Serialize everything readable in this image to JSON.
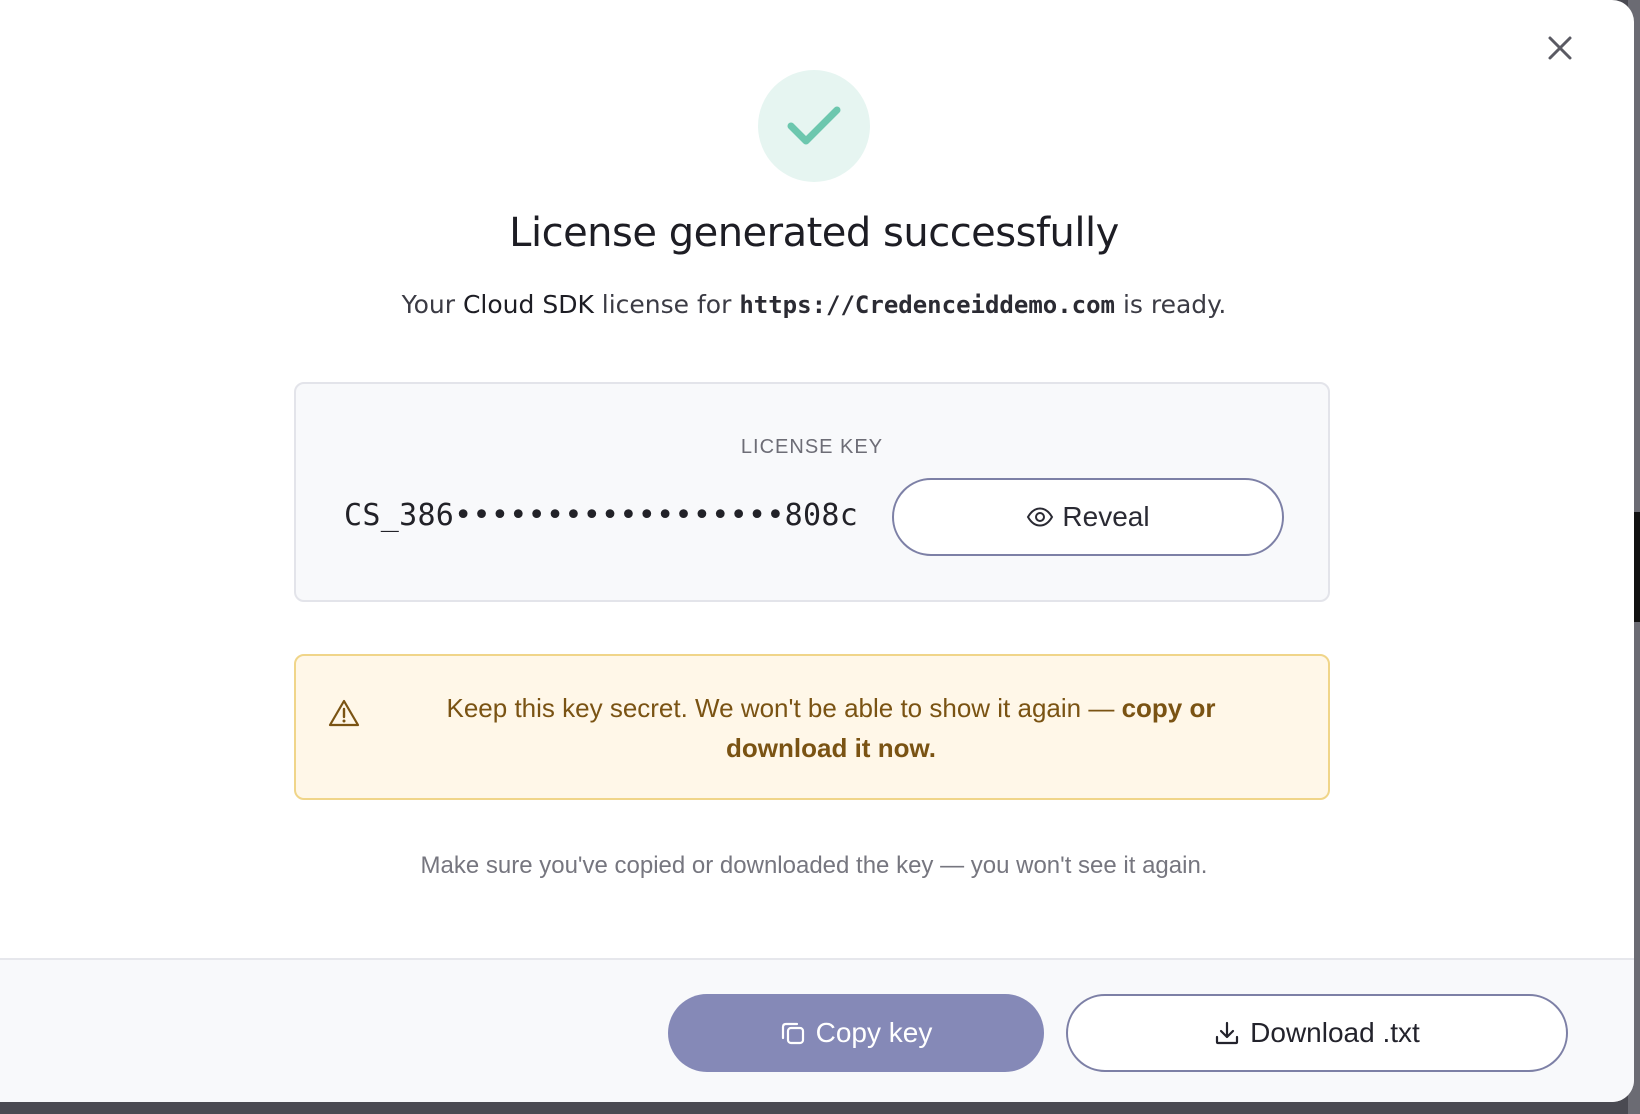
{
  "modal": {
    "title": "License generated successfully",
    "subtitle": {
      "prefix": "Your ",
      "product": "Cloud SDK",
      "middle": " license for ",
      "url": "https://Credenceiddemo.com",
      "suffix": " is ready."
    },
    "close_icon": "close-icon",
    "success_icon": "checkmark-icon"
  },
  "license_card": {
    "label": "LICENSE KEY",
    "masked_key": "CS_386••••••••••••••••••808c",
    "reveal_label": "Reveal",
    "reveal_icon": "eye-icon"
  },
  "warning": {
    "icon": "warning-triangle-icon",
    "text": "Keep this key secret. We won't be able to show it again — ",
    "emphasis": "copy or download it now."
  },
  "note": "Make sure you've copied or downloaded the key — you won't see it again.",
  "footer": {
    "copy_label": "Copy key",
    "copy_icon": "copy-icon",
    "download_label": "Download .txt",
    "download_icon": "download-icon"
  },
  "colors": {
    "success_bg": "#e6f5f1",
    "success_check": "#6cc7ae",
    "primary": "#8589b7",
    "primary_border": "#7d80a6",
    "warning_bg": "#fff7e8",
    "warning_border": "#f0d589",
    "warning_text": "#7a5313"
  }
}
